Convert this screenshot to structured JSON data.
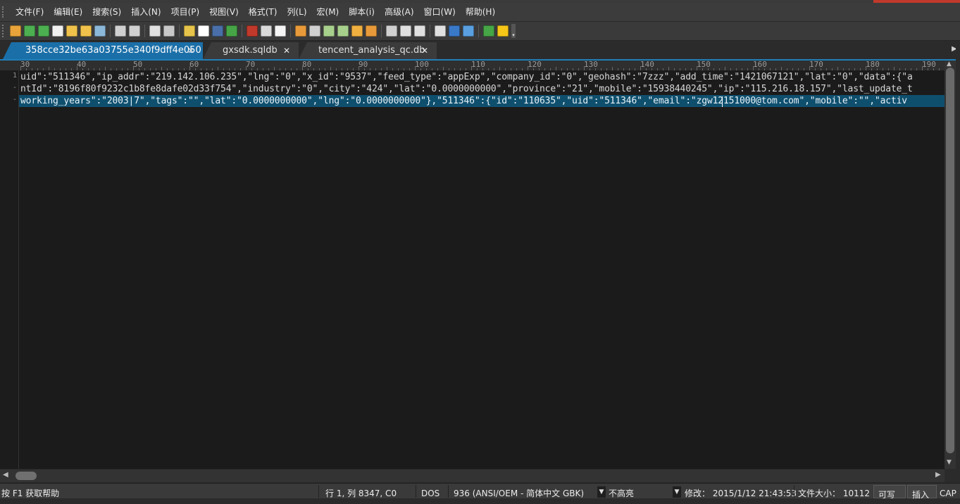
{
  "menu": {
    "items": [
      "文件(F)",
      "编辑(E)",
      "搜索(S)",
      "插入(N)",
      "项目(P)",
      "视图(V)",
      "格式(T)",
      "列(L)",
      "宏(M)",
      "脚本(i)",
      "高级(A)",
      "窗口(W)",
      "帮助(H)"
    ]
  },
  "toolbar": {
    "buttons": [
      {
        "icon": "new-file-icon",
        "color": "#e8a33a"
      },
      {
        "icon": "back-arrow-icon",
        "color": "#4caf50"
      },
      {
        "icon": "forward-arrow-icon",
        "color": "#4caf50"
      },
      {
        "icon": "blank-page-icon",
        "color": "#f0f0f0"
      },
      {
        "icon": "open-folder-icon",
        "color": "#f0c24b"
      },
      {
        "icon": "open-folder-2-icon",
        "color": "#f0c24b"
      },
      {
        "icon": "save-icon",
        "color": "#8bb7d9"
      },
      {
        "icon": "print-icon",
        "color": "#d0d0d0"
      },
      {
        "icon": "print-preview-icon",
        "color": "#d0d0d0"
      },
      {
        "icon": "list-icon",
        "color": "#e0e0e0"
      },
      {
        "icon": "hex-icon",
        "color": "#c8c8c8"
      },
      {
        "icon": "column-mode-icon",
        "color": "#e6c34a"
      },
      {
        "icon": "word-wrap-icon",
        "color": "#ffffff"
      },
      {
        "icon": "ftp-icon",
        "color": "#4a6fa8"
      },
      {
        "icon": "add-icon",
        "color": "#46a546"
      },
      {
        "icon": "spell-check-icon",
        "color": "#c0392b"
      },
      {
        "icon": "cut-icon",
        "color": "#d9d9d9"
      },
      {
        "icon": "copy-icon",
        "color": "#f5f5f5"
      },
      {
        "icon": "paste-icon",
        "color": "#e89a3a"
      },
      {
        "icon": "find-icon",
        "color": "#d0d0d0"
      },
      {
        "icon": "find-prev-icon",
        "color": "#a8d08d"
      },
      {
        "icon": "find-next-icon",
        "color": "#a8d08d"
      },
      {
        "icon": "replace-icon",
        "color": "#f0b040"
      },
      {
        "icon": "find-in-files-icon",
        "color": "#e89a3a"
      },
      {
        "icon": "replace-in-files-icon",
        "color": "#d0d0d0"
      },
      {
        "icon": "window-tile-icon",
        "color": "#e0e0e0"
      },
      {
        "icon": "window-split-icon",
        "color": "#e0e0e0"
      },
      {
        "icon": "window-cascade-icon",
        "color": "#e0e0e0"
      },
      {
        "icon": "globe-icon",
        "color": "#3a78c8"
      },
      {
        "icon": "browser-icon",
        "color": "#5aa0e0"
      },
      {
        "icon": "refresh-icon",
        "color": "#46a546"
      },
      {
        "icon": "lightbulb-icon",
        "color": "#f5c518"
      },
      {
        "icon": "help-icon",
        "color": "#3a6fc8"
      }
    ]
  },
  "tabs": [
    {
      "label": "358cce32be63a03755e340f9dff4e050",
      "close": "✕",
      "active": true
    },
    {
      "label": "gxsdk.sqldb",
      "close": "✕",
      "active": false
    },
    {
      "label": "tencent_analysis_qc.db",
      "close": "✕",
      "active": false
    }
  ],
  "ruler": {
    "labels": [
      "30",
      "40",
      "50",
      "60",
      "70",
      "80",
      "90",
      "100",
      "110",
      "120",
      "130",
      "140",
      "150",
      "160",
      "170",
      "180",
      "190"
    ]
  },
  "gutter": {
    "line_number": "1",
    "wrap_mark": "-"
  },
  "editor": {
    "lines": [
      "uid\":\"511346\",\"ip_addr\":\"219.142.106.235\",\"lng\":\"0\",\"x_id\":\"9537\",\"feed_type\":\"appExp\",\"company_id\":\"0\",\"geohash\":\"7zzz\",\"add_time\":\"1421067121\",\"lat\":\"0\",\"data\":{\"a",
      "ntId\":\"8196f80f9232c1b8fe8dafe02d33f754\",\"industry\":\"0\",\"city\":\"424\",\"lat\":\"0.0000000000\",\"province\":\"21\",\"mobile\":\"15938440245\",\"ip\":\"115.216.18.157\",\"last_update_t",
      "working_years\":\"2003|7\",\"tags\":\"\",\"lat\":\"0.0000000000\",\"lng\":\"0.0000000000\"},\"511346\":{\"id\":\"110635\",\"uid\":\"511346\",\"email\":\"zgw12151000@tom.com\",\"mobile\":\"\",\"activ"
    ]
  },
  "status": {
    "help": "按 F1 获取帮助",
    "position": "行 1, 列 8347, C0",
    "line_ending": "DOS",
    "encoding": "936   (ANSI/OEM - 简体中文 GBK)",
    "highlight": "不高亮",
    "modified": "修改：  2015/1/12 21:43:53",
    "file_size": "文件大小：  10112",
    "writable": "可写",
    "insert_mode": "插入",
    "caps": "CAP"
  }
}
